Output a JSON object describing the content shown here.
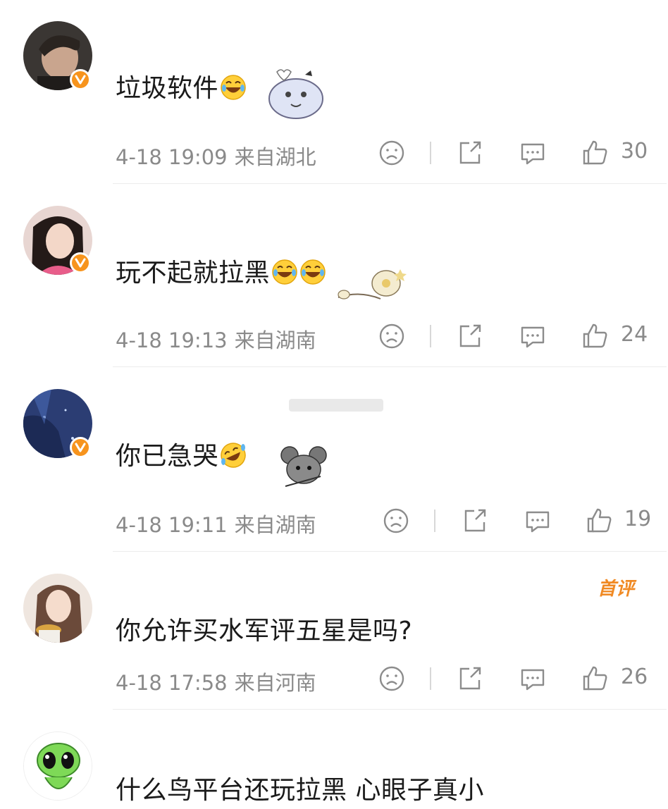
{
  "comments": [
    {
      "text": "垃圾软件",
      "emojis": [
        "laugh-cry-emoji"
      ],
      "time": "4-18 19:09",
      "location": "来自湖北",
      "likes": "30",
      "verified": true
    },
    {
      "text": "玩不起就拉黑",
      "emojis": [
        "laugh-cry-emoji",
        "laugh-cry-emoji"
      ],
      "time": "4-18 19:13",
      "location": "来自湖南",
      "likes": "24",
      "verified": true
    },
    {
      "text": "你已急哭",
      "emojis": [
        "rofl-emoji"
      ],
      "time": "4-18 19:11",
      "location": "来自湖南",
      "likes": "19",
      "verified": true
    },
    {
      "text": "你允许买水军评五星是吗?",
      "emojis": [],
      "time": "4-18 17:58",
      "location": "来自河南",
      "likes": "26",
      "verified": false,
      "badge": "首评"
    },
    {
      "text": "什么鸟平台还玩拉黑 心眼子真小",
      "emojis": [],
      "verified": false
    }
  ],
  "colors": {
    "verified_badge": "#f7941d",
    "first_badge": "#f08a24",
    "meta_text": "#8a8a8a",
    "icon_stroke": "#8c8c8c"
  },
  "icons": [
    "dislike-icon",
    "share-icon",
    "reply-icon",
    "like-icon"
  ]
}
